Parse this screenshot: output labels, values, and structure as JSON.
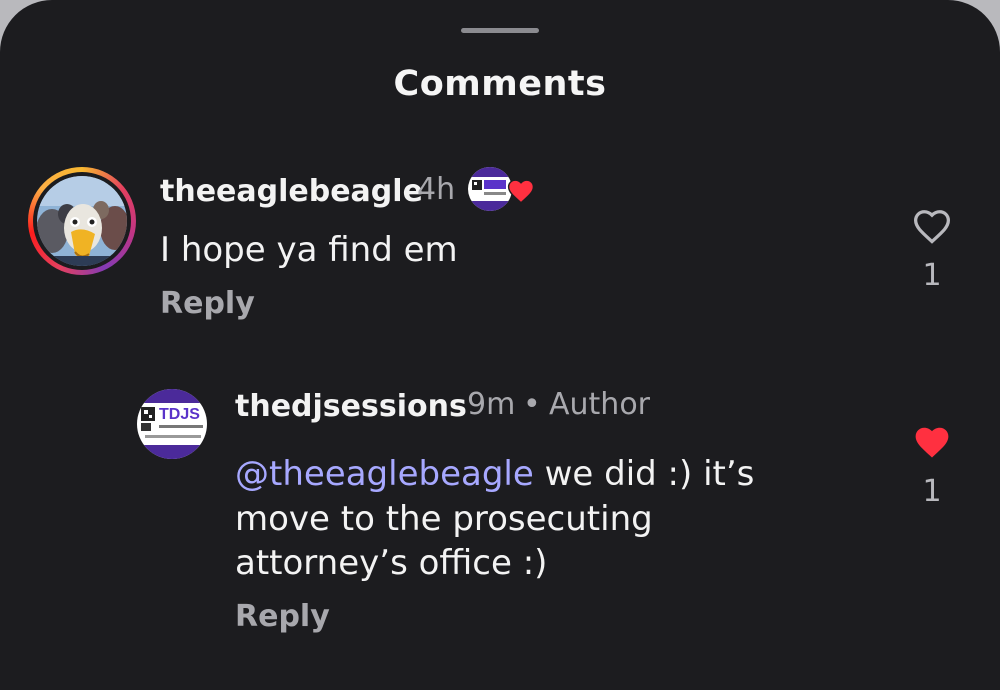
{
  "sheet": {
    "title": "Comments"
  },
  "comments": [
    {
      "username": "theeaglebeagle",
      "time": "4h",
      "text": "I hope ya find em",
      "reply_label": "Reply",
      "like_count": "1",
      "liked": false,
      "creator_liked": true
    }
  ],
  "replies": [
    {
      "username": "thedjsessions",
      "time": "9m",
      "separator": "•",
      "role": "Author",
      "mention": "@theeaglebeagle",
      "line1_rest": " we did :) it’s",
      "line2": "move to the prosecuting",
      "line3": "attorney’s office :)",
      "reply_label": "Reply",
      "like_count": "1",
      "liked": true
    }
  ],
  "colors": {
    "background": "#1c1c1f",
    "text": "#f3f3f3",
    "muted": "#a8a8ad",
    "mention": "#a7a8ff",
    "like_red": "#ff3040"
  },
  "icons": {
    "like": "heart-outline-icon",
    "liked": "heart-filled-icon"
  }
}
